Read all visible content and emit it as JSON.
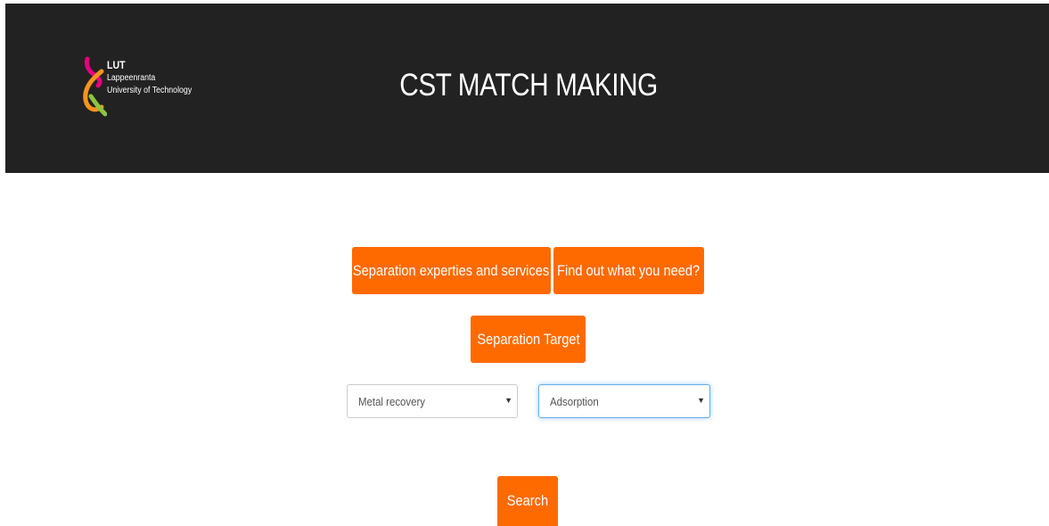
{
  "header": {
    "logo": {
      "name": "LUT",
      "line1": "Lappeenranta",
      "line2": "University of Technology"
    },
    "title": "CST MATCH MAKING"
  },
  "nav": {
    "separation_experties_label": "Separation experties and services",
    "find_out_label": "Find out what you need?",
    "separation_target_label": "Separation Target"
  },
  "filters": {
    "target_select": {
      "value": "Metal recovery"
    },
    "method_select": {
      "value": "Adsorption"
    }
  },
  "search": {
    "label": "Search"
  },
  "colors": {
    "accent": "#ff6a00",
    "header_bg": "#222222",
    "logo_magenta": "#e6007e",
    "logo_orange": "#f7941d",
    "logo_green": "#8cc63f"
  }
}
